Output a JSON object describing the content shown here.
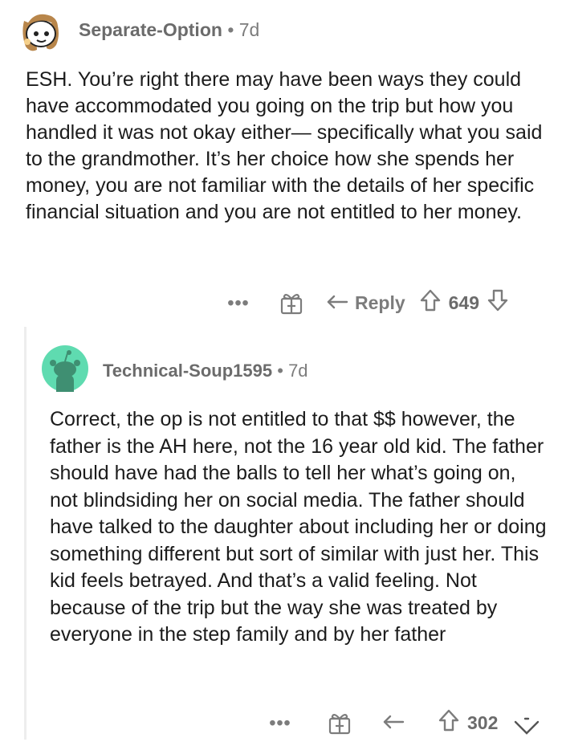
{
  "comments": [
    {
      "author": "Separate-Option",
      "separator": "•",
      "age": "7d",
      "avatar_icon": "snoo-avatar-icon",
      "body": "ESH. You’re right there may have been ways they could have accommodated you going on the trip but how you handled it was not okay either— specifically what you said to the grandmother. It’s her choice how she spends her money, you are not familiar with the details of her specific financial situation and you are not entitled to her money.",
      "actions": {
        "more": "•••",
        "reply": "Reply",
        "score": "649"
      }
    },
    {
      "author": "Technical-Soup1595",
      "separator": "•",
      "age": "7d",
      "avatar_icon": "default-snoo-avatar-icon",
      "body": "Correct, the op is not entitled to that $$ however, the father is the AH here, not the 16 year old kid.  The father should have had the balls to tell her what’s going on, not blindsiding her on social media. The father should have talked to the daughter about including her or doing something different but sort of similar with just her.   This kid feels betrayed. And that’s a valid feeling.  Not because of the trip but the way she was treated by everyone in the step family and by her father",
      "actions": {
        "more": "•••",
        "score": "302"
      }
    }
  ],
  "colors": {
    "meta_text": "#7c7c7c",
    "body_text": "#1c1c1c",
    "thread_line": "#ededed",
    "avatar2_bg": "#5fdbb0"
  }
}
